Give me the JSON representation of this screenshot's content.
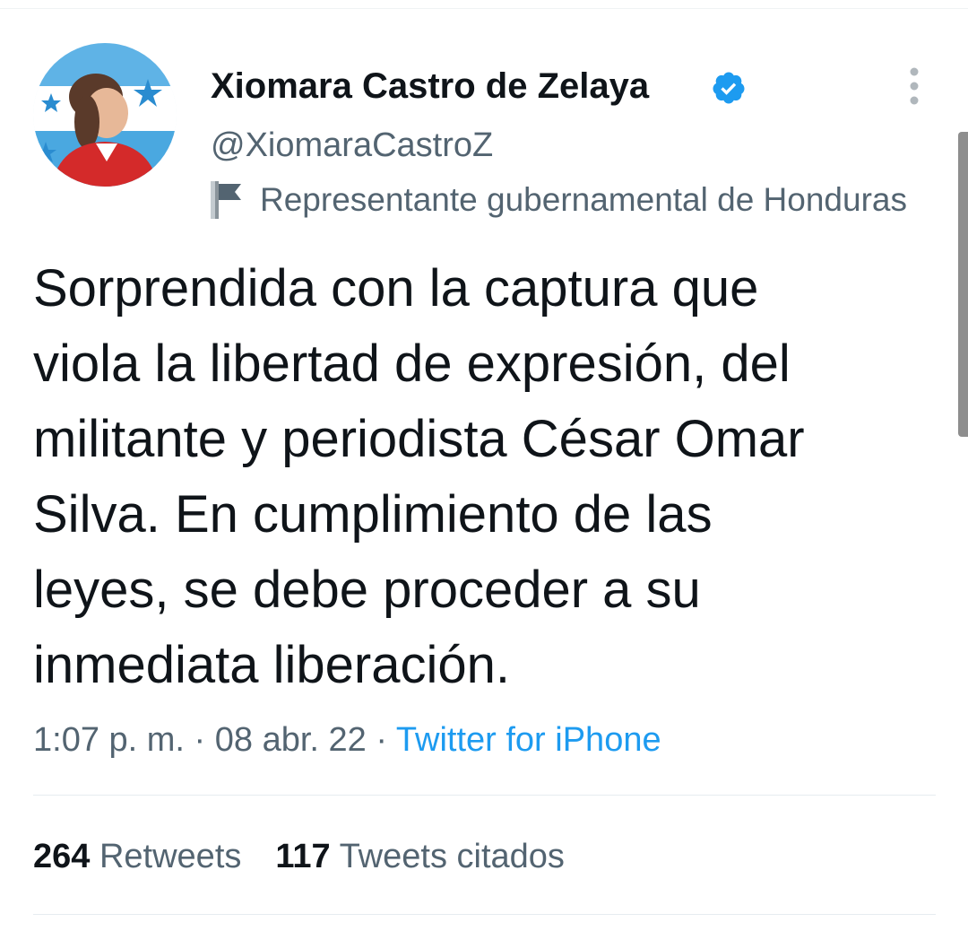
{
  "author": {
    "display_name": "Xiomara Castro de Zelaya",
    "handle": "@XiomaraCastroZ",
    "verified": true,
    "label": "Representante gubernamental de Honduras"
  },
  "tweet": {
    "text_lines": [
      "Sorprendida con la captura que",
      "viola la libertad de expresión, del",
      "militante y periodista César Omar",
      "Silva. En cumplimiento de las",
      "leyes, se debe proceder a su",
      "inmediata liberación."
    ],
    "time": "1:07 p. m.",
    "separator": " · ",
    "date": "08 abr. 22",
    "source": "Twitter for iPhone"
  },
  "stats": {
    "retweets_count": "264",
    "retweets_label": "Retweets",
    "quotes_count": "117",
    "quotes_label": "Tweets citados"
  },
  "icons": {
    "verified": "verified-badge-icon",
    "more": "more-vertical-icon",
    "label": "flag-icon"
  },
  "colors": {
    "verified_blue": "#1d9bf0",
    "link_blue": "#1d9bf0",
    "secondary_text": "#536471",
    "primary_text": "#0f1419"
  }
}
